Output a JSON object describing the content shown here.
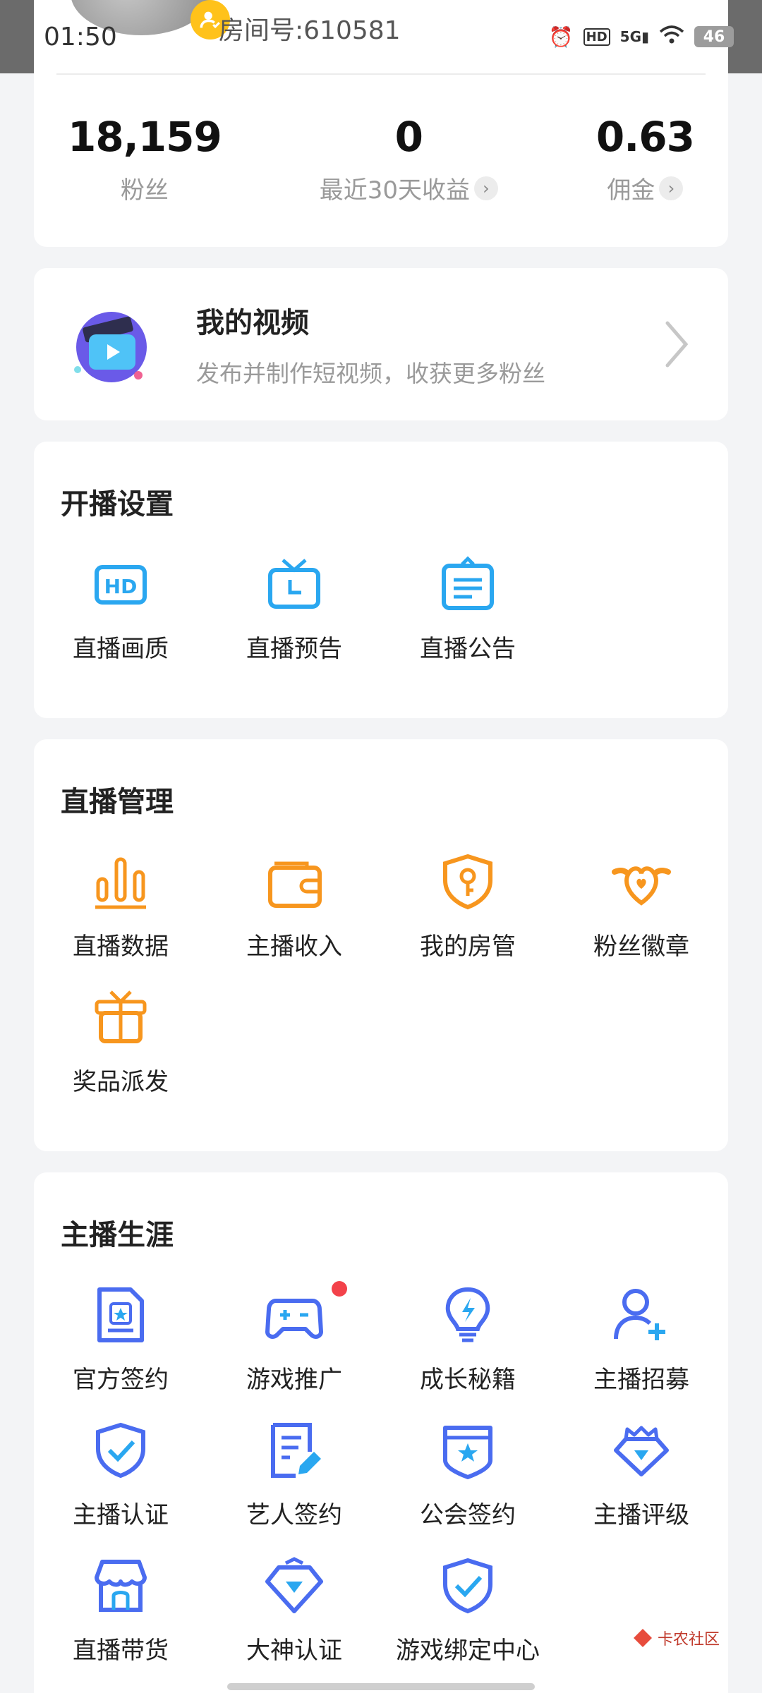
{
  "status": {
    "time": "01:50",
    "icons": [
      "alarm-icon",
      "hd-icon",
      "5g-signal-icon",
      "wifi-icon"
    ],
    "battery": "46"
  },
  "profile": {
    "room_no": "房间号:610581"
  },
  "stats": [
    {
      "value": "18,159",
      "label": "粉丝",
      "has_chevron": false
    },
    {
      "value": "0",
      "label": "最近30天收益",
      "has_chevron": true
    },
    {
      "value": "0.63",
      "label": "佣金",
      "has_chevron": true
    }
  ],
  "video": {
    "title": "我的视频",
    "subtitle": "发布并制作短视频，收获更多粉丝"
  },
  "sections": [
    {
      "title": "开播设置",
      "items": [
        {
          "label": "直播画质",
          "icon": "hd-quality-icon"
        },
        {
          "label": "直播预告",
          "icon": "tv-preview-icon"
        },
        {
          "label": "直播公告",
          "icon": "announcement-icon"
        }
      ]
    },
    {
      "title": "直播管理",
      "items": [
        {
          "label": "直播数据",
          "icon": "bar-chart-icon"
        },
        {
          "label": "主播收入",
          "icon": "wallet-icon"
        },
        {
          "label": "我的房管",
          "icon": "shield-key-icon"
        },
        {
          "label": "粉丝徽章",
          "icon": "heart-badge-icon"
        },
        {
          "label": "奖品派发",
          "icon": "gift-icon"
        }
      ]
    },
    {
      "title": "主播生涯",
      "items": [
        {
          "label": "官方签约",
          "icon": "contract-icon"
        },
        {
          "label": "游戏推广",
          "icon": "gamepad-icon",
          "dot": true
        },
        {
          "label": "成长秘籍",
          "icon": "lightbulb-icon"
        },
        {
          "label": "主播招募",
          "icon": "add-user-icon"
        },
        {
          "label": "主播认证",
          "icon": "shield-check-icon"
        },
        {
          "label": "艺人签约",
          "icon": "document-edit-icon"
        },
        {
          "label": "公会签约",
          "icon": "guild-star-icon"
        },
        {
          "label": "主播评级",
          "icon": "diamond-crown-icon"
        },
        {
          "label": "直播带货",
          "icon": "shop-icon"
        },
        {
          "label": "大神认证",
          "icon": "diamond-icon"
        },
        {
          "label": "游戏绑定中心",
          "icon": "shield-check-blue-icon"
        }
      ]
    }
  ],
  "colors": {
    "blue": "#2aa7f0",
    "orange": "#f7961e",
    "indigo": "#4a6cf0",
    "red_dot": "#f3424a"
  },
  "watermark": "卡农社区"
}
